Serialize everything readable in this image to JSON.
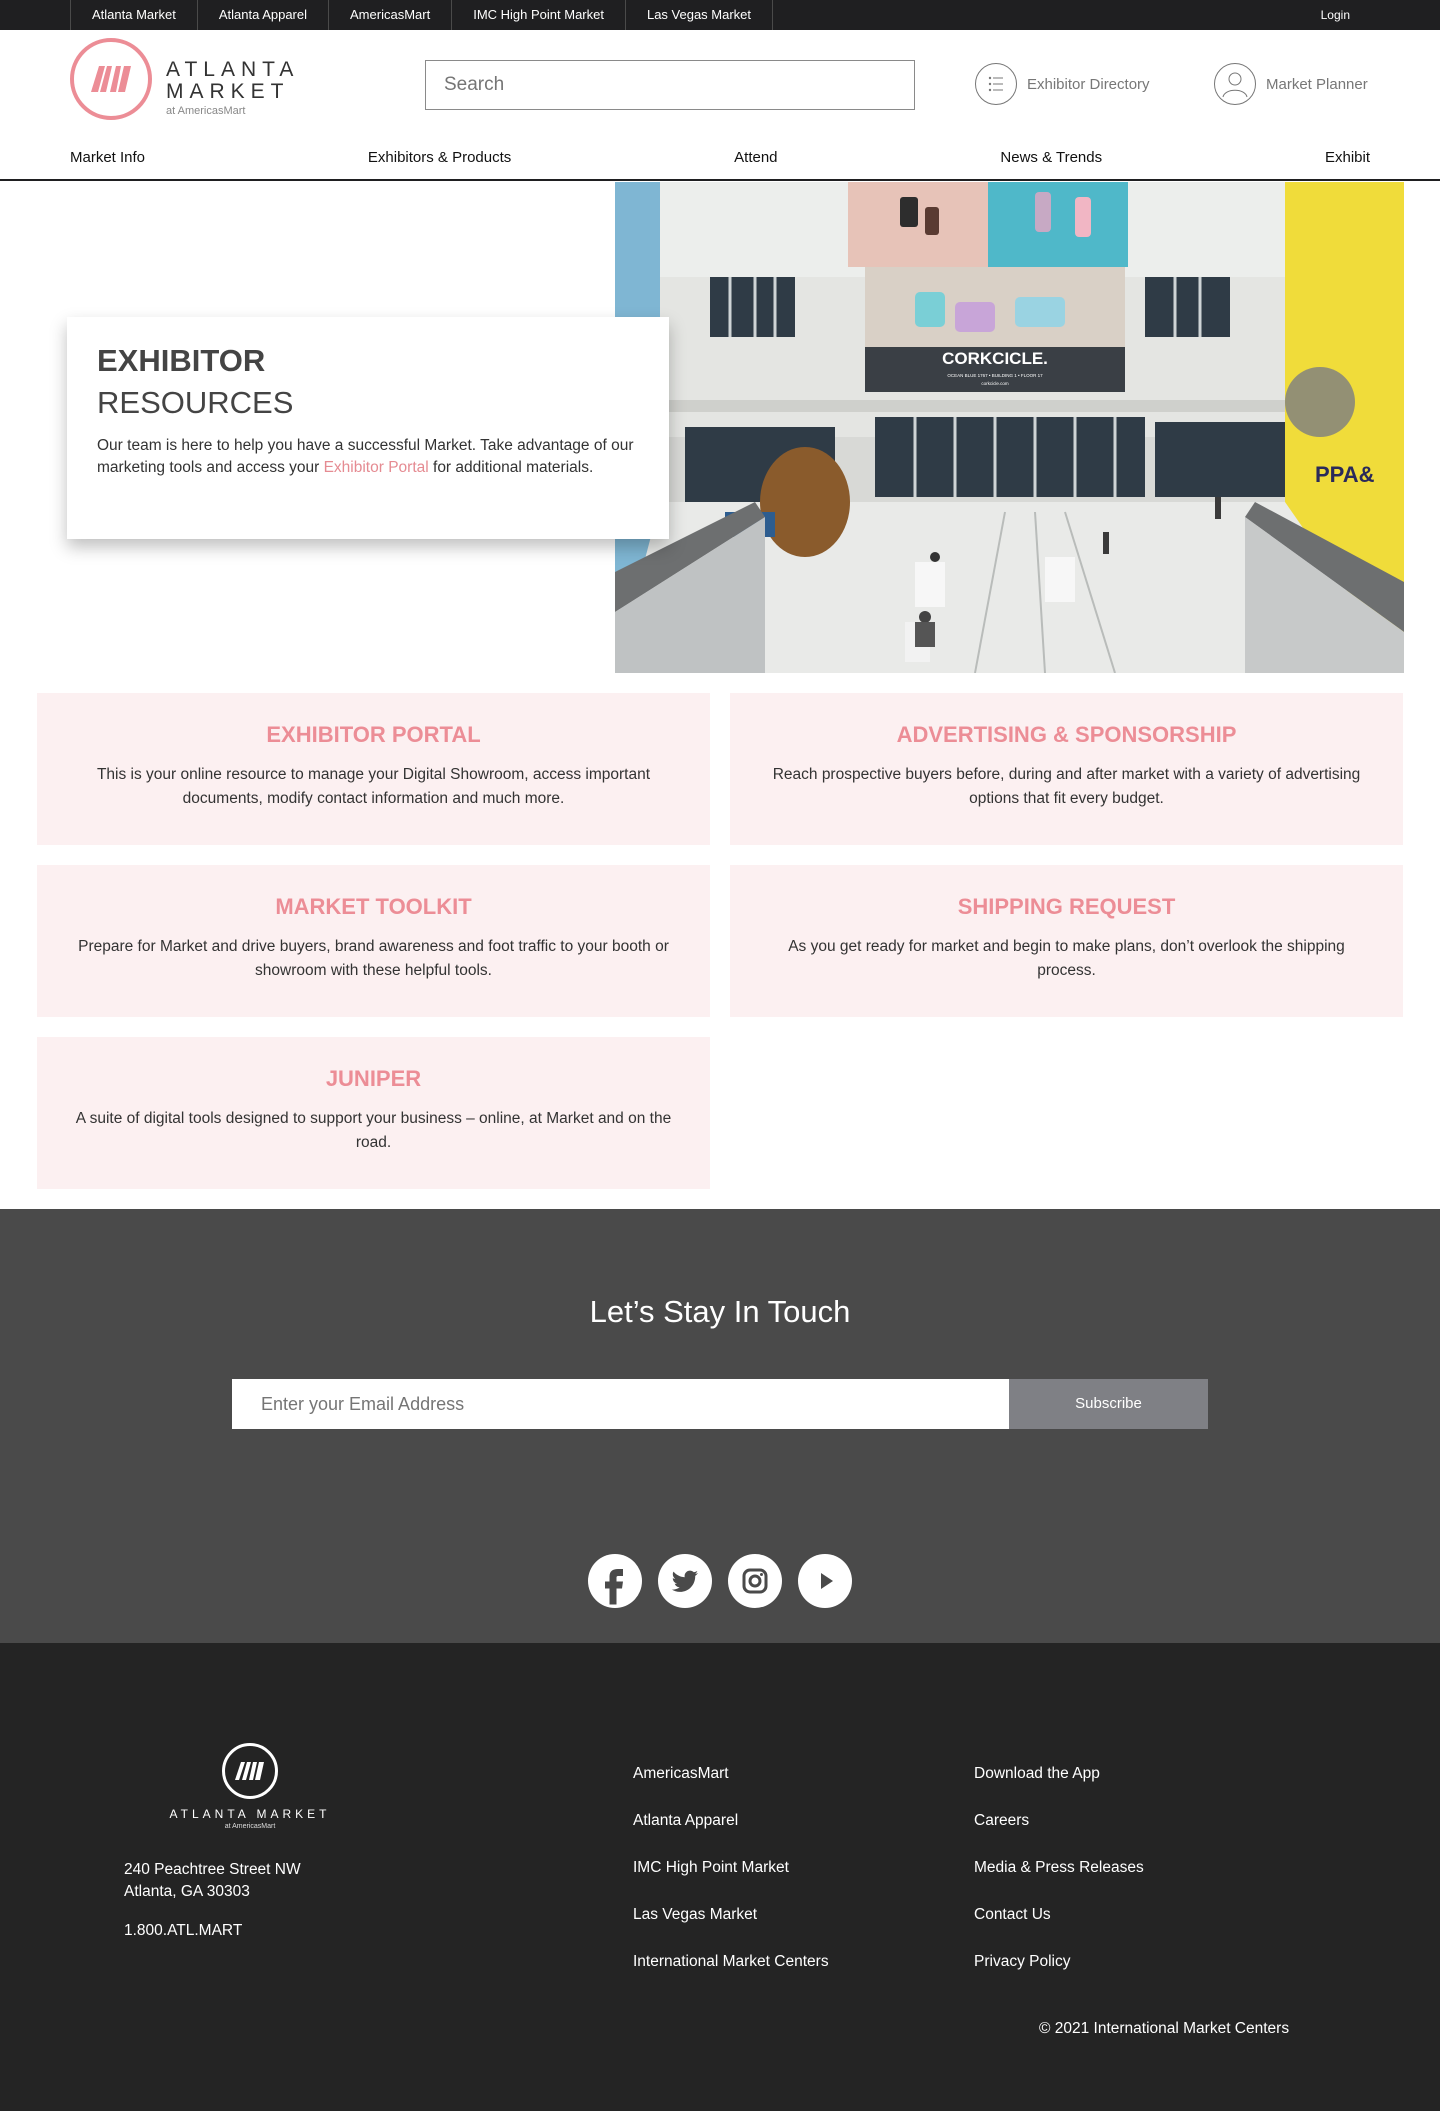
{
  "topbar": {
    "sites": [
      "Atlanta Market",
      "Atlanta Apparel",
      "AmericasMart",
      "IMC High Point Market",
      "Las Vegas Market"
    ],
    "login": "Login"
  },
  "header": {
    "logo_line1": "ATLANTA",
    "logo_line2": "MARKET",
    "logo_sub": "at AmericasMart",
    "search_placeholder": "Search",
    "exhibitor_directory": "Exhibitor Directory",
    "market_planner": "Market Planner",
    "nav": [
      "Market Info",
      "Exhibitors & Products",
      "Attend",
      "News & Trends",
      "Exhibit"
    ]
  },
  "hero": {
    "title_line1": "EXHIBITOR",
    "title_line2": "RESOURCES",
    "body_before": "Our team is here to help you have a successful Market. Take advantage of our marketing tools and access your ",
    "body_link": "Exhibitor Portal",
    "body_after": " for additional materials.",
    "image_banner": "CORKCICLE.",
    "image_banner_sub": "OCEAN BLUE 1767 • BUILDING 1 • FLOOR 17",
    "image_banner_url": "corkcicle.com"
  },
  "cards": [
    {
      "title": "EXHIBITOR PORTAL",
      "body": "This is your online resource to manage your Digital Showroom, access important documents, modify contact information and much more."
    },
    {
      "title": "ADVERTISING & SPONSORSHIP",
      "body": "Reach prospective buyers before, during and after market with a variety of advertising options that fit every budget."
    },
    {
      "title": "MARKET TOOLKIT",
      "body": "Prepare for Market and drive buyers, brand awareness and foot traffic to your booth or showroom with these helpful tools."
    },
    {
      "title": "SHIPPING REQUEST",
      "body": "As you get ready for market and begin to make plans, don’t overlook the shipping process."
    },
    {
      "title": "JUNIPER",
      "body": "A suite of digital tools designed to support your business – online, at Market and on the road."
    }
  ],
  "newsletter": {
    "title": "Let’s Stay In Touch",
    "email_placeholder": "Enter your Email Address",
    "subscribe": "Subscribe",
    "social": [
      "facebook-icon",
      "twitter-icon",
      "instagram-icon",
      "youtube-icon"
    ]
  },
  "footer": {
    "logo_name": "ATLANTA MARKET",
    "logo_sub": "at AmericasMart",
    "address_line1": "240 Peachtree Street NW",
    "address_line2": "Atlanta, GA 30303",
    "phone": "1.800.ATL.MART",
    "col1": [
      "AmericasMart",
      "Atlanta Apparel",
      "IMC High Point Market",
      "Las Vegas Market",
      "International Market Centers"
    ],
    "col2": [
      "Download the App",
      "Careers",
      "Media & Press Releases",
      "Contact Us",
      "Privacy Policy"
    ],
    "copyright": "© 2021 International Market Centers"
  },
  "colors": {
    "accent_pink": "#ec8d96",
    "card_bg": "#fcf0f1",
    "topbar_bg": "#1f1f21",
    "newsletter_bg": "#4a4a4a",
    "footer_bg": "#242424",
    "subscribe_bg": "#7f8085"
  }
}
